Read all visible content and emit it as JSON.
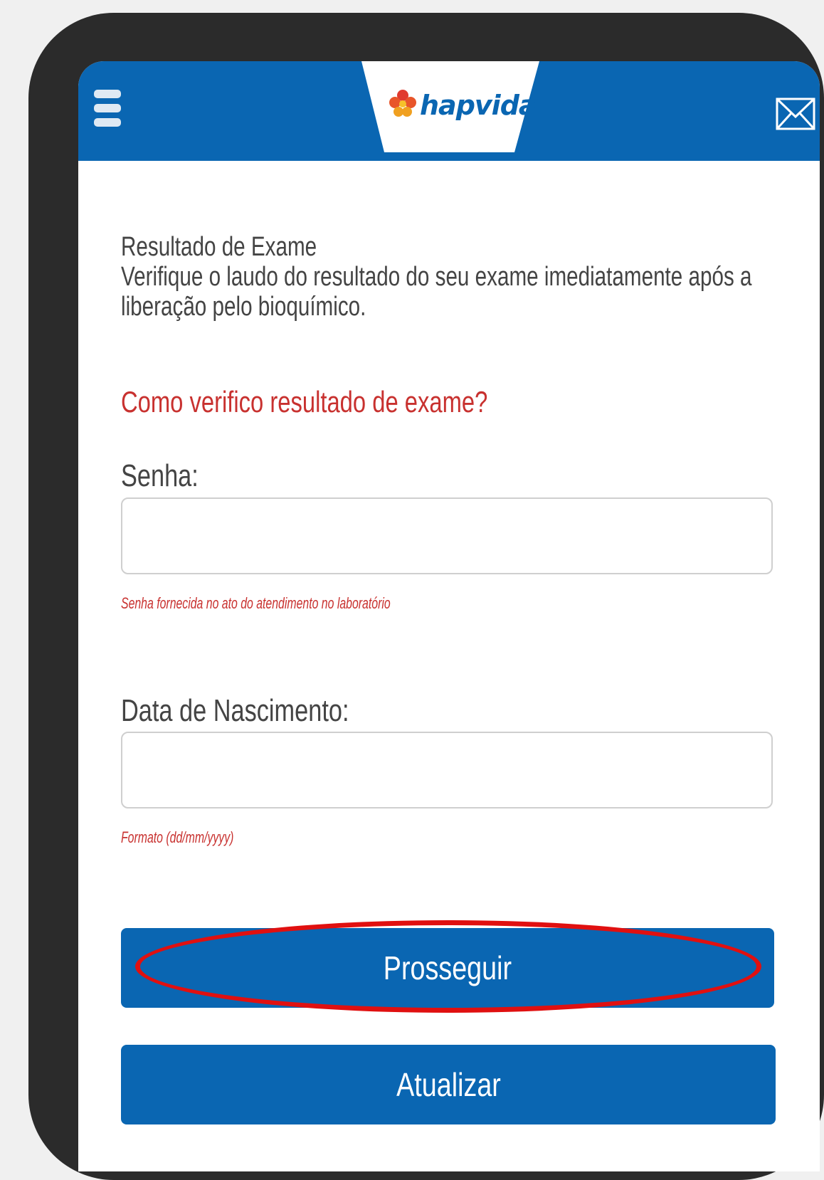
{
  "header": {
    "logo_text": "hapvida",
    "menu_icon": "hamburger-menu-icon",
    "mail_icon": "envelope-icon",
    "brand_color": "#0a66b2"
  },
  "intro": {
    "title": "Resultado de Exame",
    "description": "Verifique o laudo do resultado do seu exame imediatamente após a liberação pelo bioquímico."
  },
  "help_link": "Como verifico resultado de exame?",
  "form": {
    "password_label": "Senha:",
    "password_value": "",
    "password_hint": "Senha fornecida no ato do atendimento no laboratório",
    "birthdate_label": "Data de Nascimento:",
    "birthdate_value": "",
    "birthdate_hint": "Formato (dd/mm/yyyy)"
  },
  "actions": {
    "proceed_label": "Prosseguir",
    "refresh_label": "Atualizar"
  },
  "annotation": {
    "highlight_color": "#e01010"
  }
}
